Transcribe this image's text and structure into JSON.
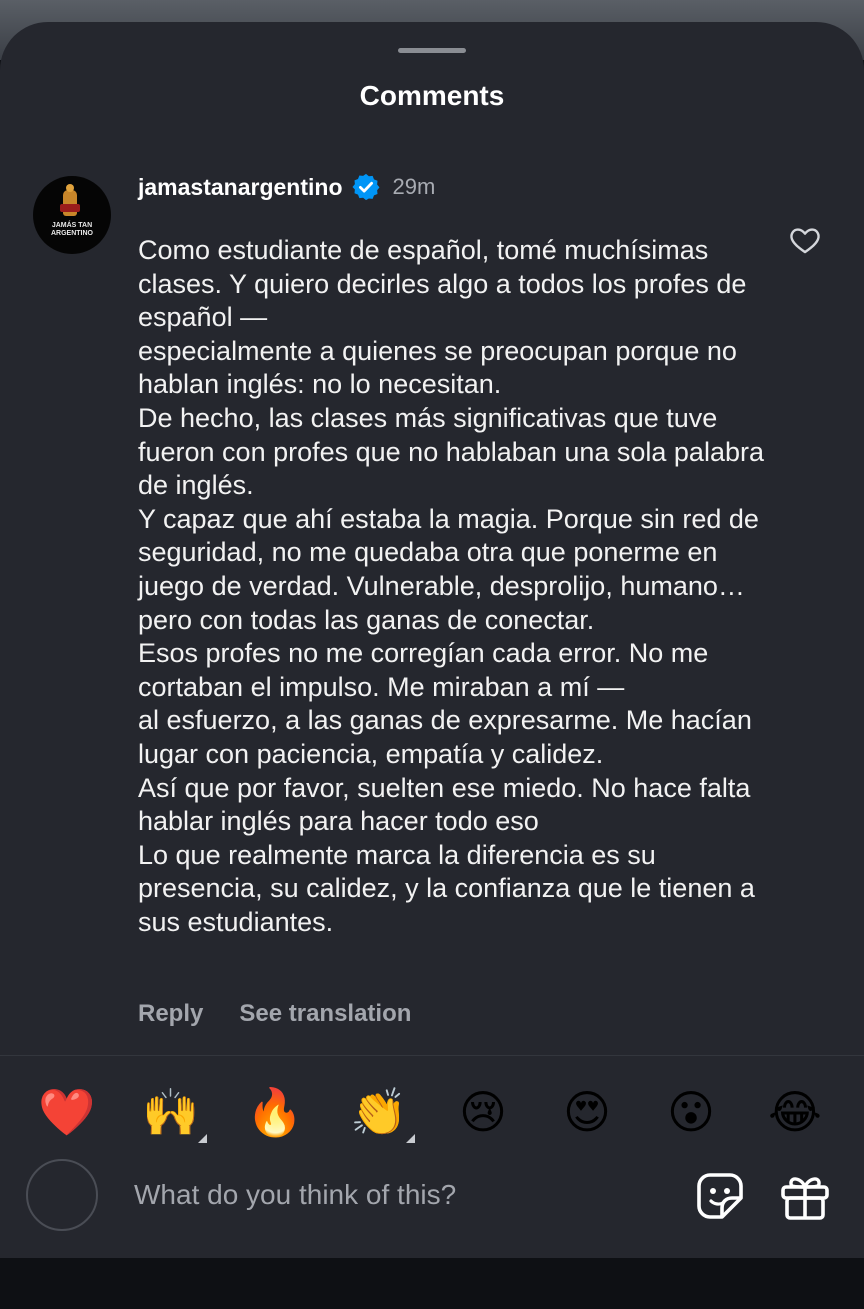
{
  "sheet": {
    "title": "Comments"
  },
  "comment": {
    "avatar_text": "JAMÁS TAN\nARGENTINO",
    "username": "jamastanargentino",
    "verified": true,
    "time": "29m",
    "text": "Como estudiante de español, tomé muchísimas clases. Y quiero decirles algo a todos los profes de español —\nespecialmente a quienes se preocupan porque no hablan inglés: no lo necesitan.\nDe hecho, las clases más significativas que tuve fueron con profes que no hablaban una sola palabra de inglés.\nY capaz que ahí estaba la magia. Porque sin red de seguridad, no me quedaba otra que ponerme en juego de verdad. Vulnerable, desprolijo, humano… pero con todas las ganas de conectar.\nEsos profes no me corregían cada error. No me cortaban el impulso. Me miraban a mí —\nal esfuerzo, a las ganas de expresarme. Me hacían lugar con paciencia, empatía y calidez.\nAsí que por favor, suelten ese miedo. No hace falta hablar inglés para hacer todo eso\nLo que realmente marca la diferencia es su presencia, su calidez, y la confianza que le tienen a sus estudiantes.",
    "reply_label": "Reply",
    "translation_label": "See translation"
  },
  "reactions": [
    {
      "emoji": "❤️",
      "name": "red-heart"
    },
    {
      "emoji": "🙌",
      "name": "raising-hands"
    },
    {
      "emoji": "🔥",
      "name": "fire"
    },
    {
      "emoji": "👏",
      "name": "clapping-hands"
    },
    {
      "emoji": "😢",
      "name": "crying-face"
    },
    {
      "emoji": "😍",
      "name": "heart-eyes"
    },
    {
      "emoji": "😮",
      "name": "surprised-face"
    },
    {
      "emoji": "😂",
      "name": "tears-of-joy"
    }
  ],
  "composer": {
    "placeholder": "What do you think of this?"
  },
  "icons": {
    "verified": "verified-badge-icon",
    "like": "heart-outline-icon",
    "sticker": "sticker-icon",
    "gift": "gift-icon"
  },
  "colors": {
    "sheet_bg": "#25272e",
    "verified_blue": "#0095f6",
    "muted_text": "#a3a6ad"
  }
}
